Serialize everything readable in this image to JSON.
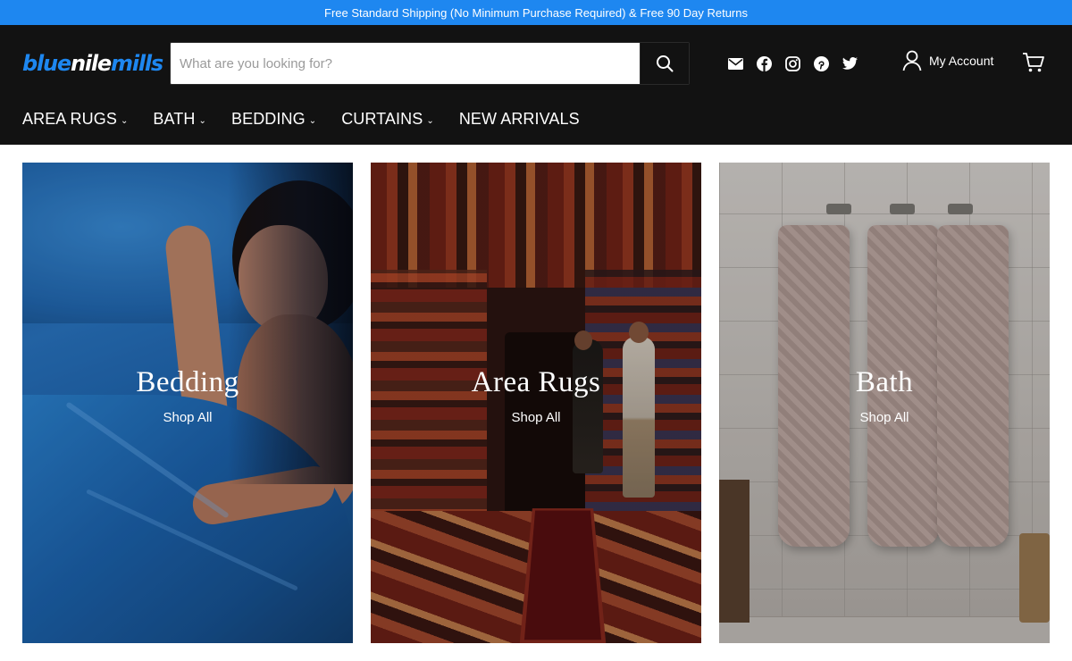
{
  "promo": {
    "text": "Free Standard Shipping (No Minimum Purchase Required) & Free 90 Day Returns"
  },
  "logo": {
    "part1": "blue",
    "part2": "nile",
    "part3": "mills"
  },
  "search": {
    "placeholder": "What are you looking for?",
    "value": ""
  },
  "social": {
    "icons": [
      "email-icon",
      "facebook-icon",
      "instagram-icon",
      "pinterest-icon",
      "twitter-icon"
    ]
  },
  "account": {
    "label": "My Account"
  },
  "nav": {
    "items": [
      {
        "label": "AREA RUGS",
        "has_dropdown": true
      },
      {
        "label": "BATH",
        "has_dropdown": true
      },
      {
        "label": "BEDDING",
        "has_dropdown": true
      },
      {
        "label": "CURTAINS",
        "has_dropdown": true
      },
      {
        "label": "NEW ARRIVALS",
        "has_dropdown": false
      }
    ]
  },
  "tiles": [
    {
      "title": "Bedding",
      "link": "Shop All"
    },
    {
      "title": "Area Rugs",
      "link": "Shop All"
    },
    {
      "title": "Bath",
      "link": "Shop All"
    }
  ],
  "colors": {
    "promo_bg": "#1e87f0",
    "header_bg": "#121212",
    "brand_blue": "#1e87f0"
  }
}
